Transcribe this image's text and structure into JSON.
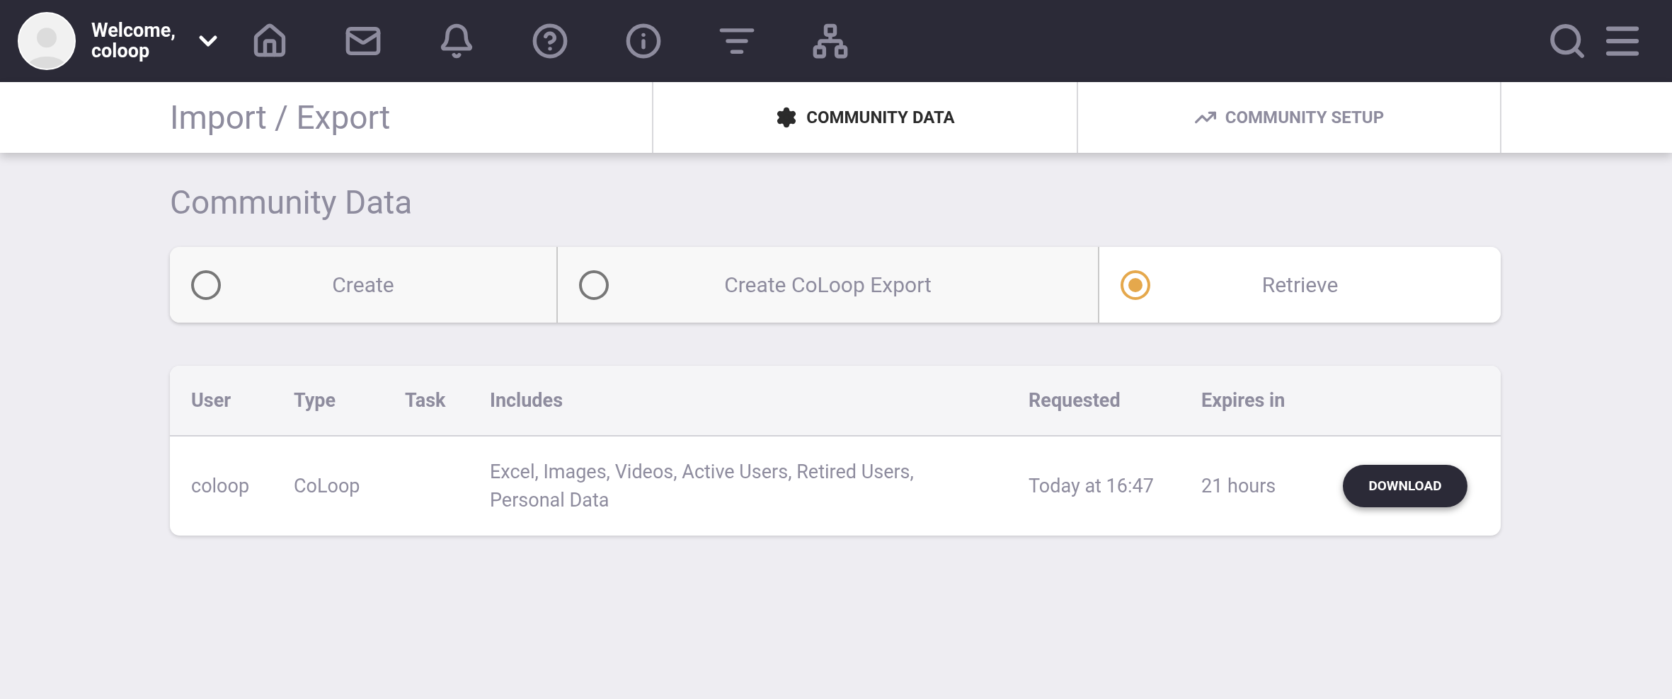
{
  "top_bar": {
    "greeting": "Welcome,",
    "username": "coloop"
  },
  "page_header": {
    "title": "Import / Export",
    "tabs": [
      {
        "label": "COMMUNITY DATA",
        "kind": "data",
        "selected": true
      },
      {
        "label": "COMMUNITY SETUP",
        "kind": "setup",
        "selected": false
      }
    ]
  },
  "section_title": "Community Data",
  "modes": [
    {
      "label": "Create",
      "selected": false
    },
    {
      "label": "Create CoLoop Export",
      "selected": false
    },
    {
      "label": "Retrieve",
      "selected": true
    }
  ],
  "table": {
    "columns": [
      "User",
      "Type",
      "Task",
      "Includes",
      "Requested",
      "Expires in"
    ],
    "rows": [
      {
        "cells": [
          "coloop",
          "CoLoop",
          "",
          "Excel, Images, Videos, Active Users, Retired Users, Personal Data",
          "Today at 16:47",
          "21 hours"
        ],
        "action": "DOWNLOAD"
      }
    ]
  }
}
